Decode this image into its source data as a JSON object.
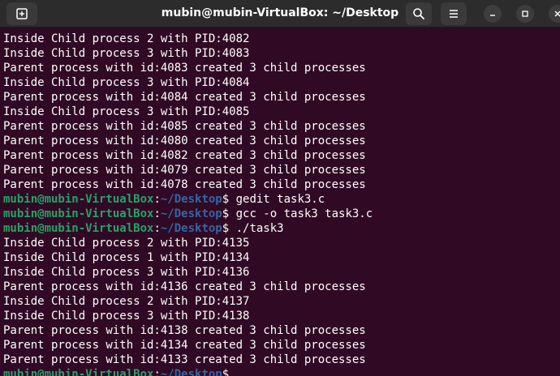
{
  "window": {
    "title": "mubin@mubin-VirtualBox: ~/Desktop"
  },
  "icons": {
    "new_tab": "new-tab-icon",
    "search": "search-icon",
    "menu": "hamburger-menu-icon",
    "minimize": "minimize-icon",
    "maximize": "maximize-icon",
    "close": "close-icon"
  },
  "colors": {
    "terminal_bg": "#300a24",
    "prompt_user": "#26a269",
    "prompt_path": "#3465a4",
    "text": "#ffffff"
  },
  "terminal": {
    "lines": [
      {
        "type": "output",
        "text": "Inside Child process 2 with PID:4082"
      },
      {
        "type": "output",
        "text": "Inside Child process 3 with PID:4083"
      },
      {
        "type": "output",
        "text": "Parent process with id:4083 created 3 child processes"
      },
      {
        "type": "output",
        "text": "Inside Child process 3 with PID:4084"
      },
      {
        "type": "output",
        "text": "Parent process with id:4084 created 3 child processes"
      },
      {
        "type": "output",
        "text": "Inside Child process 3 with PID:4085"
      },
      {
        "type": "output",
        "text": "Parent process with id:4085 created 3 child processes"
      },
      {
        "type": "output",
        "text": "Parent process with id:4080 created 3 child processes"
      },
      {
        "type": "output",
        "text": "Parent process with id:4082 created 3 child processes"
      },
      {
        "type": "output",
        "text": "Parent process with id:4079 created 3 child processes"
      },
      {
        "type": "output",
        "text": "Parent process with id:4078 created 3 child processes"
      },
      {
        "type": "prompt",
        "user": "mubin@mubin-VirtualBox",
        "sep": ":",
        "path": "~/Desktop",
        "symbol": "$ ",
        "command": "gedit task3.c"
      },
      {
        "type": "prompt",
        "user": "mubin@mubin-VirtualBox",
        "sep": ":",
        "path": "~/Desktop",
        "symbol": "$ ",
        "command": "gcc -o task3 task3.c"
      },
      {
        "type": "prompt",
        "user": "mubin@mubin-VirtualBox",
        "sep": ":",
        "path": "~/Desktop",
        "symbol": "$ ",
        "command": "./task3"
      },
      {
        "type": "output",
        "text": "Inside Child process 2 with PID:4135"
      },
      {
        "type": "output",
        "text": "Inside Child process 1 with PID:4134"
      },
      {
        "type": "output",
        "text": "Inside Child process 3 with PID:4136"
      },
      {
        "type": "output",
        "text": "Parent process with id:4136 created 3 child processes"
      },
      {
        "type": "output",
        "text": "Inside Child process 2 with PID:4137"
      },
      {
        "type": "output",
        "text": "Inside Child process 3 with PID:4138"
      },
      {
        "type": "output",
        "text": "Parent process with id:4138 created 3 child processes"
      },
      {
        "type": "output",
        "text": "Parent process with id:4134 created 3 child processes"
      },
      {
        "type": "output",
        "text": "Parent process with id:4133 created 3 child processes"
      },
      {
        "type": "prompt",
        "user": "mubin@mubin-VirtualBox",
        "sep": ":",
        "path": "~/Desktop",
        "symbol": "$ ",
        "command": ""
      }
    ]
  }
}
